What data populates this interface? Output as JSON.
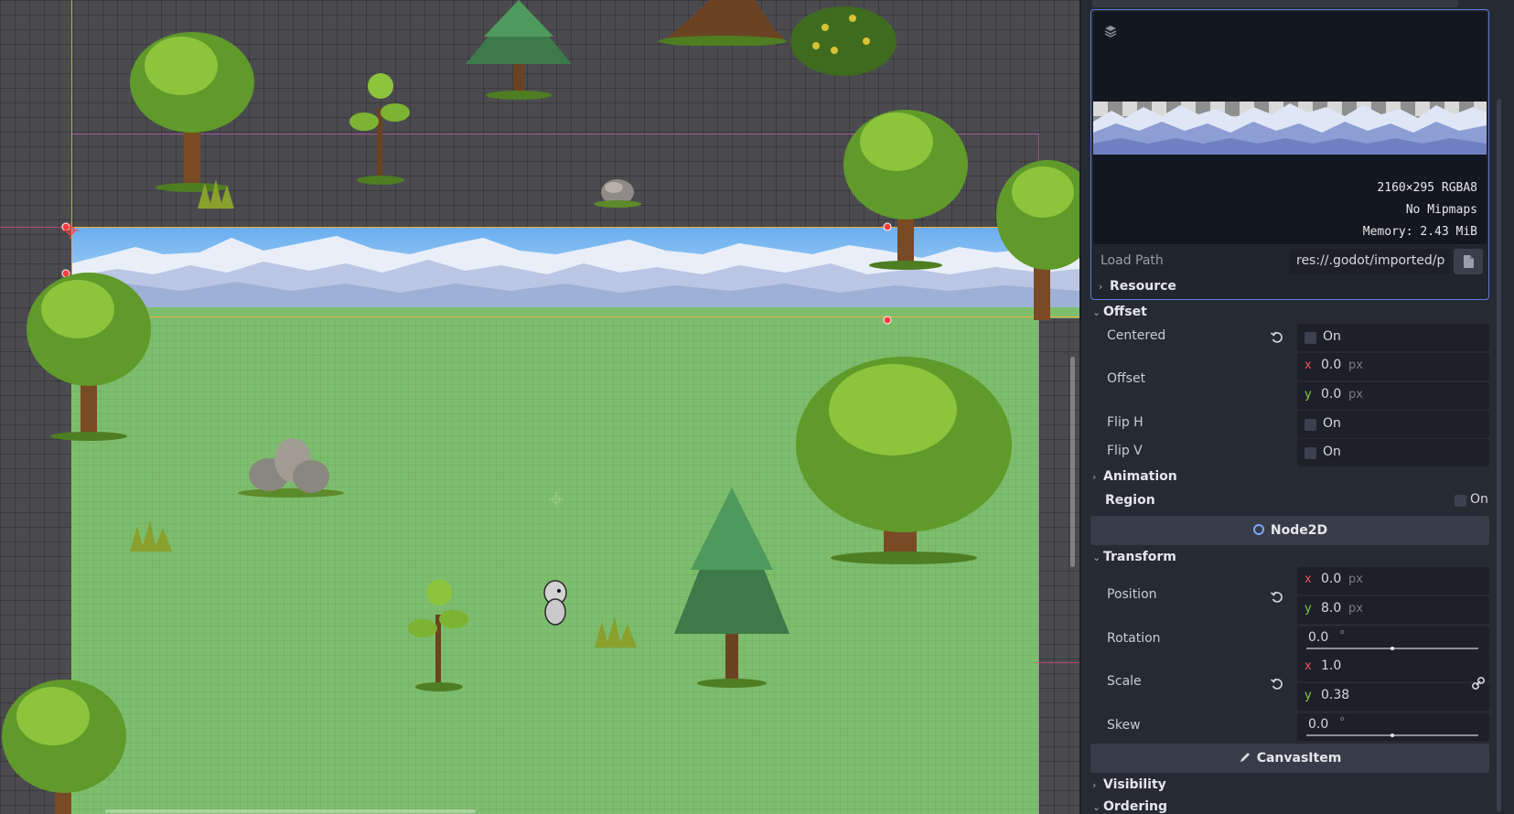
{
  "texture_preview": {
    "info_lines": [
      "2160×295 RGBA8",
      "No Mipmaps",
      "Memory: 2.43 MiB"
    ],
    "load_path_label": "Load Path",
    "load_path_value": "res://.godot/imported/p",
    "resource_label": "Resource"
  },
  "offset_section": {
    "title": "Offset",
    "centered_label": "Centered",
    "centered_value": "On",
    "offset_label": "Offset",
    "offset_x": "0.0",
    "offset_y": "0.0",
    "flip_h_label": "Flip H",
    "flip_h_value": "On",
    "flip_v_label": "Flip V",
    "flip_v_value": "On"
  },
  "animation_section": {
    "title": "Animation"
  },
  "region": {
    "label": "Region",
    "value": "On"
  },
  "node2d_header": "Node2D",
  "transform_section": {
    "title": "Transform",
    "position_label": "Position",
    "position_x": "0.0",
    "position_y": "8.0",
    "rotation_label": "Rotation",
    "rotation_value": "0.0",
    "rotation_unit": "°",
    "scale_label": "Scale",
    "scale_x": "1.0",
    "scale_y": "0.38",
    "skew_label": "Skew",
    "skew_value": "0.0",
    "skew_unit": "°"
  },
  "canvasitem_header": "CanvasItem",
  "visibility_section": {
    "title": "Visibility"
  },
  "ordering_section": {
    "title": "Ordering"
  },
  "units": {
    "px": "px",
    "x": "x",
    "y": "y"
  },
  "colors": {
    "viewport_bg": "#4b4b4f",
    "grass": "#7dbe6e",
    "selection": "#f2a83a",
    "handle": "#ff3b3b",
    "inspector_bg": "#262a33",
    "accent_blue": "#5b7fd8"
  }
}
